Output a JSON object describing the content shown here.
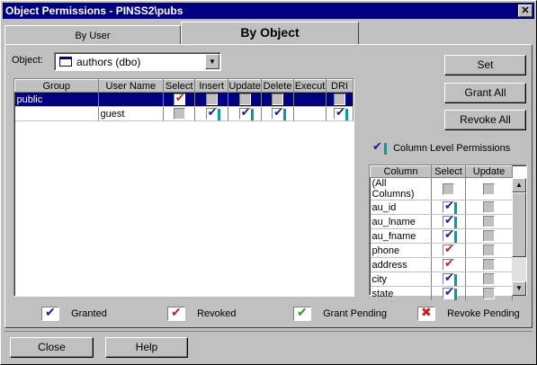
{
  "window": {
    "title": "Object Permissions - PINSS2\\pubs",
    "close_glyph": "✕"
  },
  "tabs": [
    {
      "label": "By User",
      "active": false
    },
    {
      "label": "By Object",
      "active": true
    }
  ],
  "object_selector": {
    "label": "Object:",
    "value": "authors (dbo)"
  },
  "permissions_grid": {
    "columns": [
      "Group",
      "User Name",
      "Select",
      "Insert",
      "Update",
      "Delete",
      "Execut",
      "DRI"
    ],
    "rows": [
      {
        "group": "public",
        "user": "",
        "select": "revoked",
        "insert": "none",
        "update": "none",
        "delete": "none",
        "execute": "",
        "dri": "none",
        "selected": true
      },
      {
        "group": "",
        "user": "guest",
        "select": "none",
        "insert": "granted",
        "update": "granted",
        "delete": "granted",
        "execute": "",
        "dri": "granted",
        "selected": false
      }
    ]
  },
  "buttons": {
    "set": "Set",
    "grant_all": "Grant All",
    "revoke_all": "Revoke All",
    "close": "Close",
    "help": "Help"
  },
  "column_level": {
    "label": "Column Level Permissions",
    "columns": [
      "Column",
      "Select",
      "Update"
    ],
    "rows": [
      {
        "name": "(All Columns)",
        "select": "none",
        "update": "none"
      },
      {
        "name": "au_id",
        "select": "granted",
        "update": "none"
      },
      {
        "name": "au_lname",
        "select": "granted",
        "update": "none"
      },
      {
        "name": "au_fname",
        "select": "granted",
        "update": "none"
      },
      {
        "name": "phone",
        "select": "revoked",
        "update": "none"
      },
      {
        "name": "address",
        "select": "revoked",
        "update": "none"
      },
      {
        "name": "city",
        "select": "granted",
        "update": "none"
      },
      {
        "name": "state",
        "select": "granted",
        "update": "none"
      }
    ]
  },
  "legend": [
    {
      "label": "Granted",
      "icon": "granted-check-icon",
      "color": "#1a1aa0"
    },
    {
      "label": "Revoked",
      "icon": "revoked-check-icon",
      "color": "#c02020"
    },
    {
      "label": "Grant Pending",
      "icon": "grant-pending-icon",
      "color": "#20a020"
    },
    {
      "label": "Revoke Pending",
      "icon": "revoke-pending-icon",
      "color": "#c02020"
    }
  ],
  "colors": {
    "titlebar": "#000080",
    "selection": "#000080",
    "face": "#c0c0c0"
  }
}
